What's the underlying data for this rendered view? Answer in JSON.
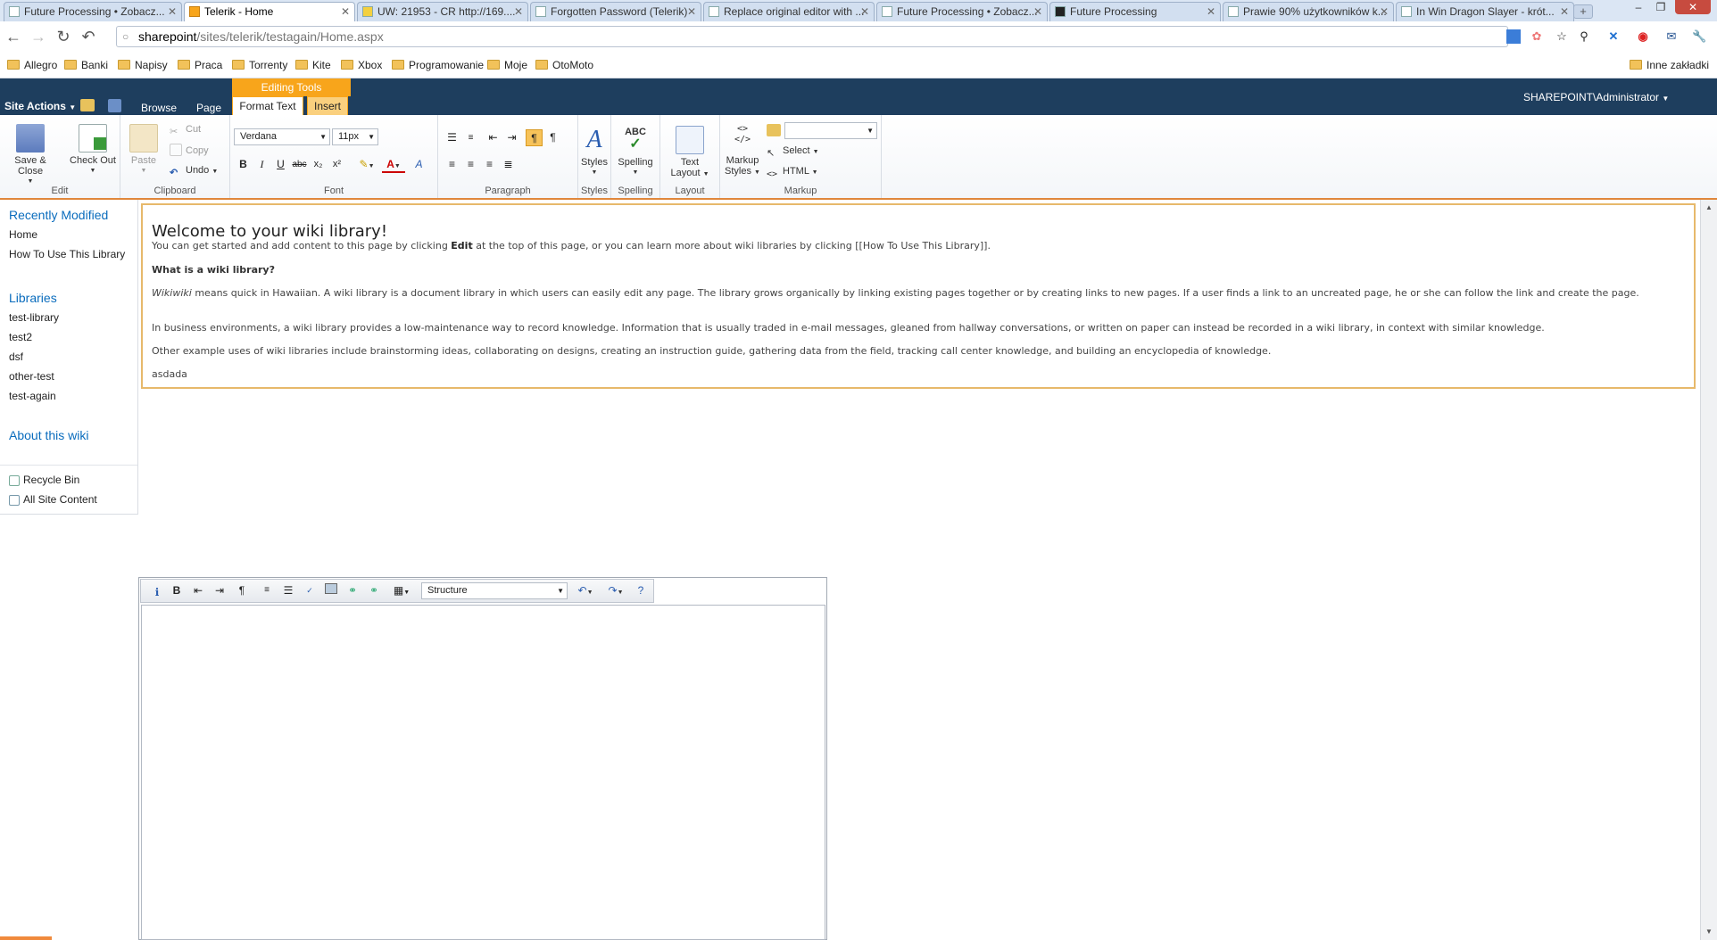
{
  "browser": {
    "tabs": [
      {
        "title": "Future Processing • Zobacz..."
      },
      {
        "title": "Telerik - Home"
      },
      {
        "title": "UW: 21953 - CR http://169...."
      },
      {
        "title": "Forgotten Password (Telerik)"
      },
      {
        "title": "Replace original editor with ..."
      },
      {
        "title": "Future Processing • Zobacz..."
      },
      {
        "title": "Future Processing"
      },
      {
        "title": "Prawie 90% użytkowników k..."
      },
      {
        "title": "In Win Dragon Slayer - krót..."
      }
    ],
    "url_host": "sharepoint",
    "url_path": "/sites/telerik/testagain/Home.aspx",
    "bookmarks": [
      "Allegro",
      "Banki",
      "Napisy",
      "Praca",
      "Torrenty",
      "Kite",
      "Xbox",
      "Programowanie",
      "Moje",
      "OtoMoto"
    ],
    "other_bookmarks": "Inne zakładki"
  },
  "sp": {
    "site_actions": "Site Actions",
    "browse": "Browse",
    "page": "Page",
    "editing_tools": "Editing Tools",
    "format_text": "Format Text",
    "insert": "Insert",
    "user": "SHAREPOINT\\Administrator"
  },
  "ribbon": {
    "edit": {
      "save_close": "Save & Close",
      "check_out": "Check Out",
      "label": "Edit"
    },
    "clipboard": {
      "paste": "Paste",
      "cut": "Cut",
      "copy": "Copy",
      "undo": "Undo",
      "label": "Clipboard"
    },
    "font": {
      "family": "Verdana",
      "size": "11px",
      "label": "Font"
    },
    "paragraph": {
      "label": "Paragraph"
    },
    "styles": {
      "button": "Styles",
      "label": "Styles"
    },
    "spelling": {
      "button": "Spelling",
      "label": "Spelling"
    },
    "layout": {
      "button_line1": "Text",
      "button_line2": "Layout",
      "label": "Layout"
    },
    "markup": {
      "styles_line1": "Markup",
      "styles_line2": "Styles",
      "select": "Select",
      "html": "HTML",
      "label": "Markup"
    }
  },
  "leftnav": {
    "recently_modified": "Recently Modified",
    "recent_items": [
      "Home",
      "How To Use This Library"
    ],
    "libraries": "Libraries",
    "library_items": [
      "test-library",
      "test2",
      "dsf",
      "other-test",
      "test-again"
    ],
    "about": "About this wiki",
    "recycle_bin": "Recycle Bin",
    "all_site_content": "All Site Content"
  },
  "content": {
    "heading": "Welcome to your wiki library!",
    "intro_before": "You can get started and add content to this page by clicking ",
    "intro_bold": "Edit",
    "intro_after": " at the top of this page, or you can learn more about wiki libraries by clicking [[How To Use This Library]].",
    "what_is": "What is a wiki library?",
    "wiki_em": "Wikiwiki",
    "p1_rest": " means quick in Hawaiian. A wiki library is a document library in which users can easily edit any page. The library grows organically by linking existing pages together or by creating links to new pages. If a user finds a link to an uncreated page, he or she can follow the link and create the page.",
    "p2": "In business environments, a wiki library provides a low-maintenance way to record knowledge. Information that is usually traded in e-mail messages, gleaned from hallway conversations, or written on paper can instead be recorded in a wiki library, in context with similar knowledge.",
    "p3": "Other example uses of wiki libraries include brainstorming ideas, collaborating on designs, creating an instruction guide, gathering data from the field, tracking call center knowledge, and building an encyclopedia of knowledge.",
    "p4": "asdada"
  },
  "editor": {
    "format_block": "Structure"
  },
  "colors": {
    "sp_header": "#1e3e5e",
    "accent_orange": "#f8a51b",
    "link_blue": "#0a6cbd"
  }
}
